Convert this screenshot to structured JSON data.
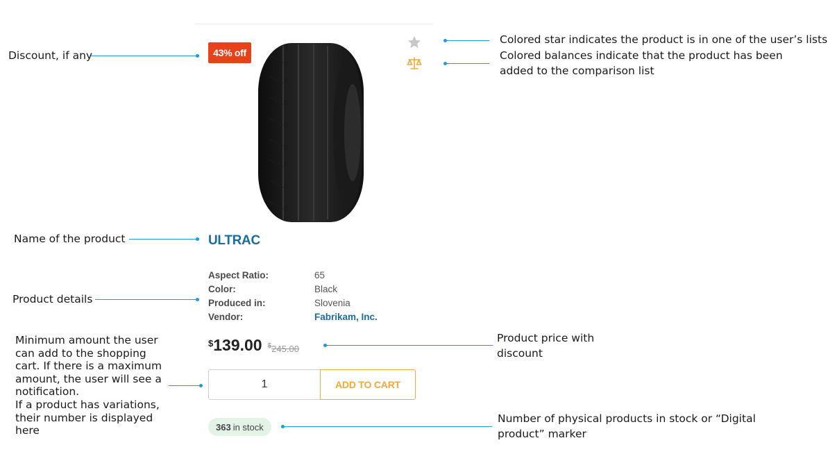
{
  "product": {
    "discount_badge": "43% off",
    "name": "ULTRAC",
    "details": [
      {
        "label": "Aspect Ratio:",
        "value": "65"
      },
      {
        "label": "Color:",
        "value": "Black"
      },
      {
        "label": "Produced in:",
        "value": "Slovenia"
      },
      {
        "label": "Vendor:",
        "value": "Fabrikam, Inc."
      }
    ],
    "price": {
      "currency": "$",
      "amount": "139.00",
      "old_currency": "$",
      "old_amount": "245.00"
    },
    "quantity": "1",
    "add_to_cart_label": "ADD TO CART",
    "stock": {
      "count": "363",
      "label": "in stock"
    }
  },
  "annotations": {
    "discount": "Discount, if any",
    "star": "Colored star indicates the product is in one of the user’s lists",
    "balances_line1": "Colored balances indicate that the product has been",
    "balances_line2": "added to the comparison list",
    "name": "Name of the product",
    "details": "Product details",
    "min_amount": "Minimum amount the user can add to the shopping cart. If there is a maximum amount, the user will see a notification.",
    "variations": "If a product has variations, their number is displayed here",
    "price_line1": "Product price with",
    "price_line2": "discount",
    "stock_line1": "Number of physical products in stock or “Digital",
    "stock_line2": "product” marker"
  },
  "colors": {
    "accent": "#1e9bd7",
    "discount_badge": "#e8421a",
    "link": "#1a6e9e",
    "cart_button": "#f0a93c",
    "stock_badge_bg": "#e3f4e6"
  },
  "icons": {
    "favorite": "star-icon",
    "compare": "scale-icon"
  }
}
